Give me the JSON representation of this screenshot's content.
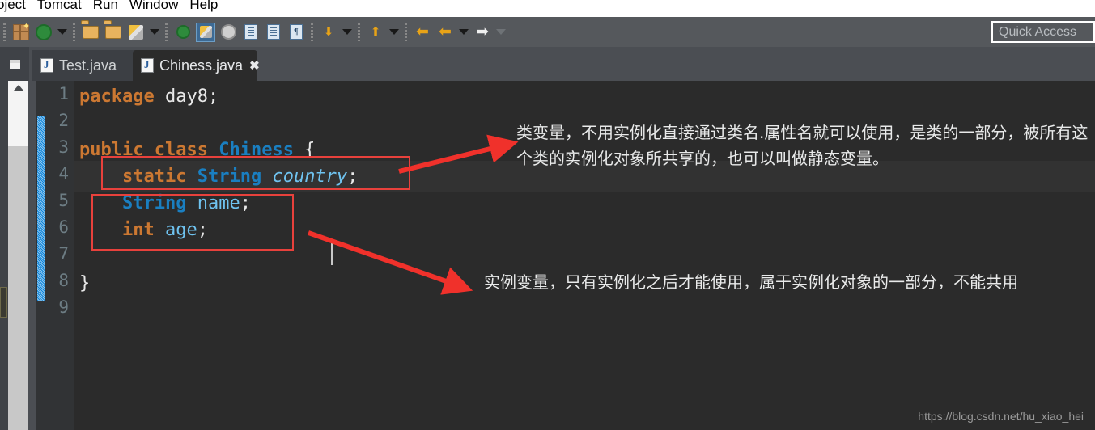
{
  "menubar": {
    "items": [
      {
        "label": "oject"
      },
      {
        "label": "Tomcat"
      },
      {
        "label": "Run"
      },
      {
        "label": "Window"
      },
      {
        "label": "Help"
      }
    ]
  },
  "toolbar": {
    "buttons": [
      {
        "name": "new-wizard",
        "icon": "new-grid-icon"
      },
      {
        "name": "new-java-class",
        "icon": "green-c-icon"
      },
      {
        "name": "new-dropdown",
        "icon": "caret-down-icon"
      },
      {
        "name": "open-type",
        "icon": "open-folder-purple-icon"
      },
      {
        "name": "open-resource",
        "icon": "open-folder-icon"
      },
      {
        "name": "save",
        "icon": "pencil-icon"
      },
      {
        "name": "save-dropdown",
        "icon": "caret-down-icon"
      },
      {
        "name": "debug",
        "icon": "debug-bug-icon"
      },
      {
        "name": "run",
        "icon": "run-highlight-icon"
      },
      {
        "name": "external-tools",
        "icon": "gear-tools-icon"
      },
      {
        "name": "new-java-project",
        "icon": "doc-arrow-icon"
      },
      {
        "name": "open-doc",
        "icon": "doc-lines-icon"
      },
      {
        "name": "toggle-mark",
        "icon": "paragraph-icon"
      },
      {
        "name": "import",
        "icon": "import-down-icon"
      },
      {
        "name": "import-dropdown",
        "icon": "caret-down-icon"
      },
      {
        "name": "export",
        "icon": "export-up-icon"
      },
      {
        "name": "export-dropdown",
        "icon": "caret-down-icon"
      },
      {
        "name": "back-history",
        "icon": "back-arrow-annotated-icon"
      },
      {
        "name": "back",
        "icon": "back-arrow-icon"
      },
      {
        "name": "back-dropdown",
        "icon": "caret-down-icon"
      },
      {
        "name": "forward",
        "icon": "forward-arrow-icon"
      },
      {
        "name": "forward-dropdown",
        "icon": "caret-down-dim-icon"
      }
    ]
  },
  "quick_access": {
    "placeholder": "Quick Access"
  },
  "tabs": [
    {
      "label": "Test.java",
      "active": false,
      "closable": false
    },
    {
      "label": "Chiness.java",
      "active": true,
      "closable": true,
      "close_glyph": "✖"
    }
  ],
  "editor": {
    "line_numbers": [
      "1",
      "2",
      "3",
      "4",
      "5",
      "6",
      "7",
      "8",
      "9"
    ],
    "lines": [
      {
        "n": "1",
        "tokens": [
          {
            "t": "package",
            "c": "kw"
          },
          {
            "t": " ",
            "c": "pln"
          },
          {
            "t": "day8;",
            "c": "pln"
          }
        ]
      },
      {
        "n": "2",
        "tokens": []
      },
      {
        "n": "3",
        "tokens": [
          {
            "t": "public",
            "c": "kw"
          },
          {
            "t": " ",
            "c": "pln"
          },
          {
            "t": "class",
            "c": "kw"
          },
          {
            "t": " ",
            "c": "pln"
          },
          {
            "t": "Chiness",
            "c": "typ"
          },
          {
            "t": " {",
            "c": "pln"
          }
        ]
      },
      {
        "n": "4",
        "tokens": [
          {
            "t": "    ",
            "c": "pln"
          },
          {
            "t": "static",
            "c": "kw"
          },
          {
            "t": " ",
            "c": "pln"
          },
          {
            "t": "String",
            "c": "typ"
          },
          {
            "t": " ",
            "c": "pln"
          },
          {
            "t": "country",
            "c": "fld-i"
          },
          {
            "t": ";",
            "c": "pln"
          }
        ]
      },
      {
        "n": "5",
        "tokens": [
          {
            "t": "    ",
            "c": "pln"
          },
          {
            "t": "String",
            "c": "typ"
          },
          {
            "t": " ",
            "c": "pln"
          },
          {
            "t": "name",
            "c": "fld"
          },
          {
            "t": ";",
            "c": "pln"
          }
        ]
      },
      {
        "n": "6",
        "tokens": [
          {
            "t": "    ",
            "c": "pln"
          },
          {
            "t": "int",
            "c": "kw"
          },
          {
            "t": " ",
            "c": "pln"
          },
          {
            "t": "age",
            "c": "fld"
          },
          {
            "t": ";",
            "c": "pln"
          }
        ]
      },
      {
        "n": "7",
        "tokens": []
      },
      {
        "n": "8",
        "tokens": [
          {
            "t": "}",
            "c": "pln"
          }
        ]
      },
      {
        "n": "9",
        "tokens": []
      }
    ],
    "current_line": "4"
  },
  "annotations": {
    "accent_color": "#e8413c",
    "static_note": "类变量，不用实例化直接通过类名.属性名就可以使用，是类的一部分，被所有这个类的实例化对象所共享的，也可以叫做静态变量。",
    "instance_note": "实例变量，只有实例化之后才能使用，属于实例化对象的一部分，不能共用"
  },
  "watermark": {
    "text": "https://blog.csdn.net/hu_xiao_hei"
  }
}
